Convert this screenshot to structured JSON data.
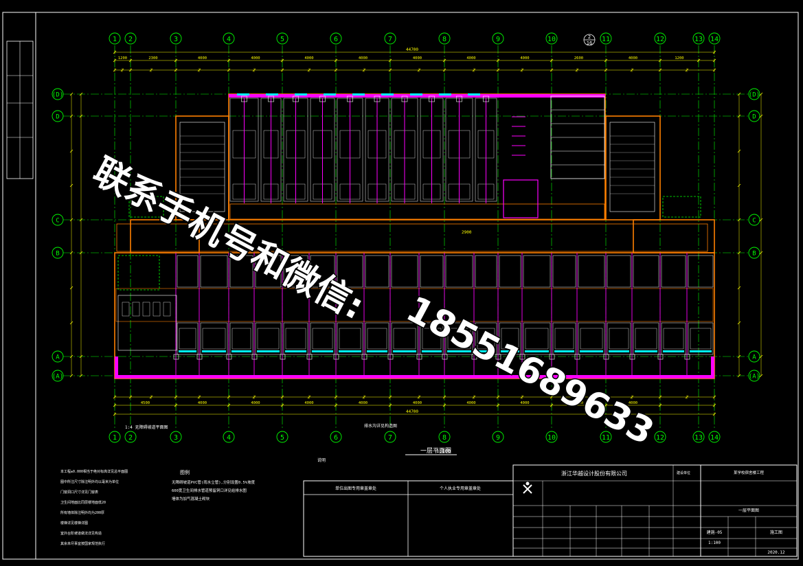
{
  "drawing": {
    "axis_labels_top": [
      "1",
      "2",
      "3",
      "4",
      "5",
      "6",
      "7",
      "8",
      "9",
      "10",
      "11",
      "12",
      "13",
      "14"
    ],
    "axis_labels_bottom": [
      "1",
      "2",
      "3",
      "4",
      "5",
      "6",
      "7",
      "8",
      "9",
      "10",
      "11",
      "12",
      "13",
      "14"
    ],
    "axis_labels_side": [
      "(D)",
      "D",
      "C",
      "B",
      "A",
      "(A)"
    ],
    "overall_dim": "44700",
    "top_dims": [
      "1200",
      "2300",
      "4000",
      "4000",
      "4000",
      "4000",
      "4000",
      "4000",
      "4000",
      "2600",
      "4000",
      "1200"
    ],
    "bottom_dims": [
      "4500",
      "4000",
      "4000",
      "4000",
      "4000",
      "4000",
      "4000",
      "4000",
      "4000",
      "4000"
    ],
    "plan_title": "一层平面图",
    "plan_scale": "1:100",
    "detail_ref_a": "2",
    "detail_ref_b": "16",
    "bottom_note_left": "1:4 无障碍坡道平面图",
    "bottom_note_right": "排水沟详见构造图",
    "dim_2900": "2900"
  },
  "notes": {
    "heading": "说明",
    "line1": "本工程±0.000相当于绝对标高详见总平面图",
    "line2": "图中所注尺寸除注明外均以毫米为单位",
    "line3": "门窗洞口尺寸详见门窗表",
    "line4": "卫生间地面比同层楼地面低20",
    "line5": "所有墙体除注明外均为200厚",
    "line6": "楼梯详见楼梯详图",
    "line7": "室外台阶坡道做法详见构造",
    "line8": "其余未尽事宜按国家规范执行"
  },
  "legend": {
    "heading": "图例",
    "item1": "无障碍坡道PVC管(雨水立管),分别设置0.5%坡度",
    "item2": "600宽卫生间排水管道预留洞口详见给排水图",
    "item3": "墙体为加气混凝土砌块"
  },
  "title_block": {
    "company": "浙江华越设计股份有限公司",
    "stamp_left": "单位出图专用章盖章处",
    "stamp_right": "个人执业专用章盖章处",
    "project_label": "建设单位",
    "project_name": "某学校宿舍楼工程",
    "drawing_name": "一层平面图",
    "drawing_no": "建施-05",
    "scale": "1:100",
    "date": "2020.12",
    "phase": "施工图"
  },
  "watermark": {
    "line1": "联系手机号和微信:",
    "line2": "18551689633"
  },
  "colors": {
    "background": "#000000",
    "axis": "#00ff00",
    "wall": "#ff7f00",
    "door": "#ff00ff",
    "window": "#00ffff",
    "dim": "#ffff00",
    "frame": "#ffffff"
  }
}
